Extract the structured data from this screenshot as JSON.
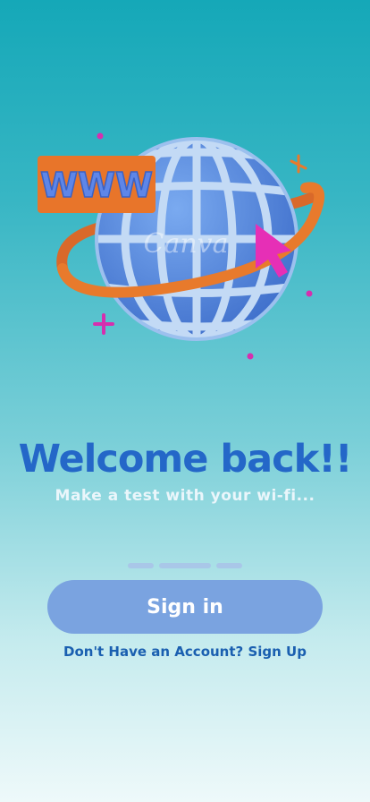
{
  "illustration": {
    "badge_text": "WWW",
    "watermark": "Canva",
    "colors": {
      "globe": "#5b8fe0",
      "grid": "#bcd6f2",
      "ring": "#e87a2c",
      "badge": "#e8752a",
      "cursor": "#e62fb6"
    }
  },
  "welcome": {
    "title": "Welcome back!!",
    "subtitle": "Make a test with your wi-fi..."
  },
  "pager": {
    "dots": 3,
    "active_index": 1
  },
  "actions": {
    "sign_in_label": "Sign in",
    "signup_text": "Don't Have an Account? Sign Up"
  },
  "colors": {
    "title": "#2467c8",
    "button": "#7aa3e0",
    "link": "#1a5fb0"
  }
}
